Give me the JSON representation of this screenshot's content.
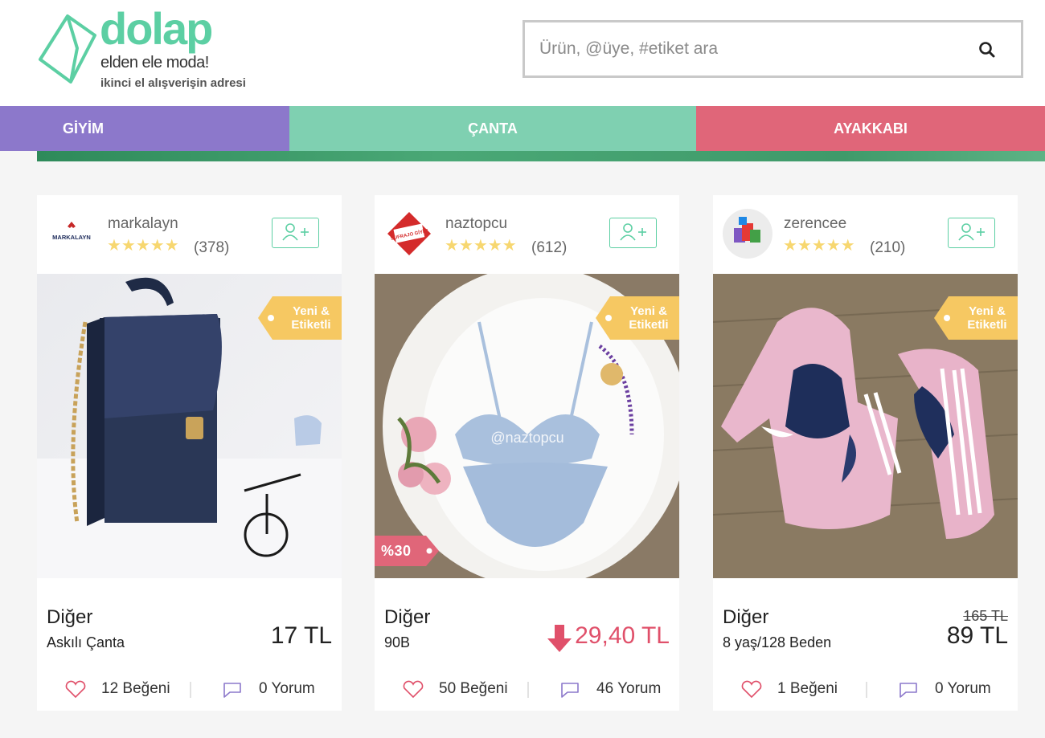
{
  "brand": {
    "name": "dolap",
    "tagline": "elden ele moda!",
    "subtitle": "ikinci el alışverişin adresi",
    "accent": "#5ccfa3"
  },
  "search": {
    "placeholder": "Ürün, @üye, #etiket ara",
    "icon": "search-icon"
  },
  "nav": {
    "tabs": [
      {
        "label": "GİYİM",
        "color": "#8c78cb"
      },
      {
        "label": "ÇANTA",
        "color": "#7fd0b1"
      },
      {
        "label": "AYAKKABI",
        "color": "#e06679"
      }
    ]
  },
  "products": [
    {
      "seller": "markalayn",
      "rating_stars": 5,
      "rating_count": "(378)",
      "avatar_text": "MARKALAYN",
      "tag": "Yeni & Etiketli",
      "category": "Diğer",
      "description": "Askılı Çanta",
      "price": "17 TL",
      "likes": "12 Beğeni",
      "comments": "0 Yorum"
    },
    {
      "seller": "naztopcu",
      "rating_stars": 5,
      "rating_count": "(612)",
      "avatar_text": "SUFRAJO GİYİM",
      "tag": "Yeni & Etiketli",
      "discount": "%30",
      "watermark": "@naztopcu",
      "category": "Diğer",
      "description": "90B",
      "price": "29,40 TL",
      "likes": "50 Beğeni",
      "comments": "46 Yorum"
    },
    {
      "seller": "zerencee",
      "rating_stars": 5,
      "rating_count": "(210)",
      "tag": "Yeni & Etiketli",
      "category": "Diğer",
      "description": "8 yaş/128 Beden",
      "old_price": "165 TL",
      "price": "89 TL",
      "likes": "1 Beğeni",
      "comments": "0 Yorum"
    }
  ],
  "colors": {
    "tag_yellow": "#f6c862",
    "discount_pink": "#e0506a",
    "star": "#f7d770"
  }
}
